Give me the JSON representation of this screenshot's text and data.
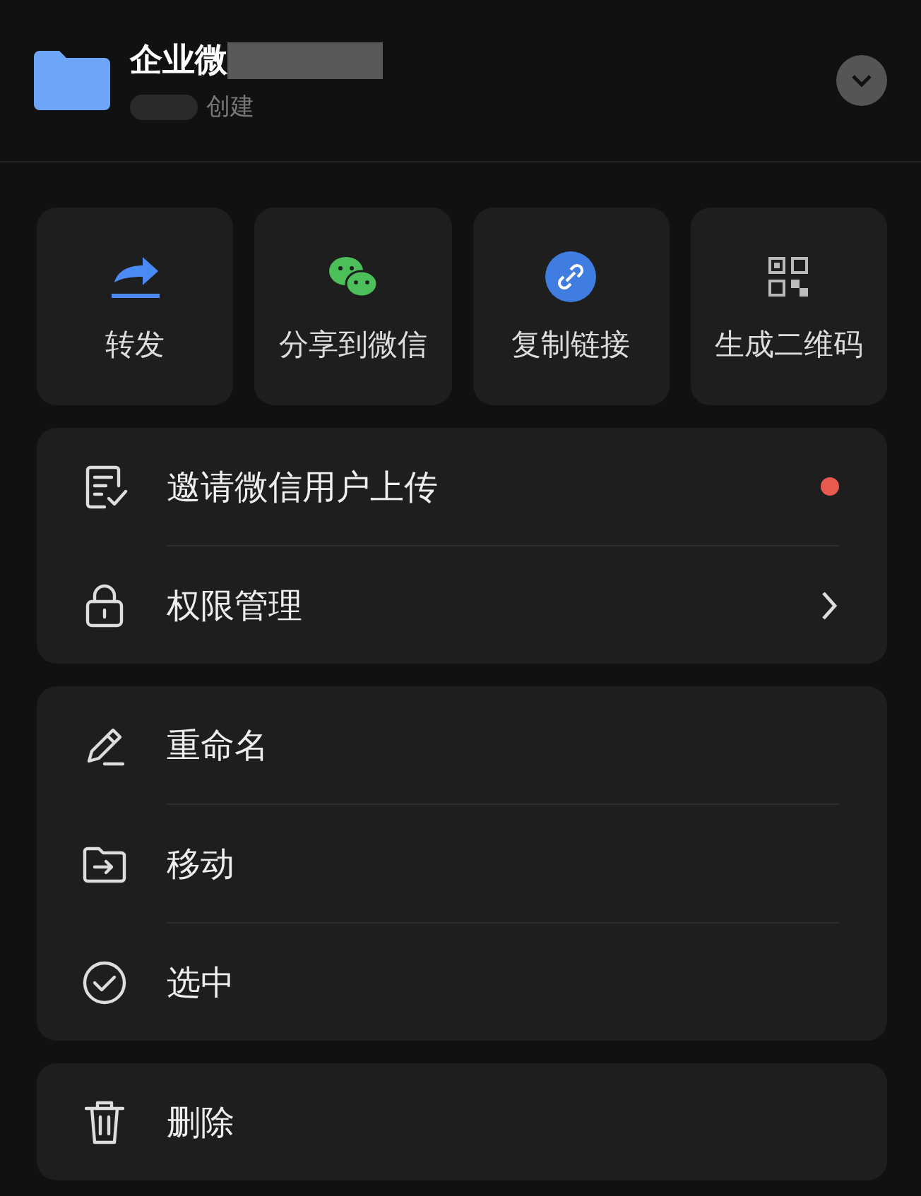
{
  "header": {
    "title": "企业微",
    "subtitle": "创建"
  },
  "actions": [
    {
      "kind": "forward",
      "label": "转发"
    },
    {
      "kind": "wechat",
      "label": "分享到微信"
    },
    {
      "kind": "link",
      "label": "复制链接"
    },
    {
      "kind": "qr",
      "label": "生成二维码"
    }
  ],
  "groups": [
    [
      {
        "kind": "invite",
        "label": "邀请微信用户上传",
        "unread": true,
        "chevron": false
      },
      {
        "kind": "lock",
        "label": "权限管理",
        "unread": false,
        "chevron": true
      }
    ],
    [
      {
        "kind": "rename",
        "label": "重命名",
        "unread": false,
        "chevron": false
      },
      {
        "kind": "move",
        "label": "移动",
        "unread": false,
        "chevron": false
      },
      {
        "kind": "select",
        "label": "选中",
        "unread": false,
        "chevron": false
      }
    ],
    [
      {
        "kind": "delete",
        "label": "删除",
        "unread": false,
        "chevron": false
      }
    ]
  ]
}
